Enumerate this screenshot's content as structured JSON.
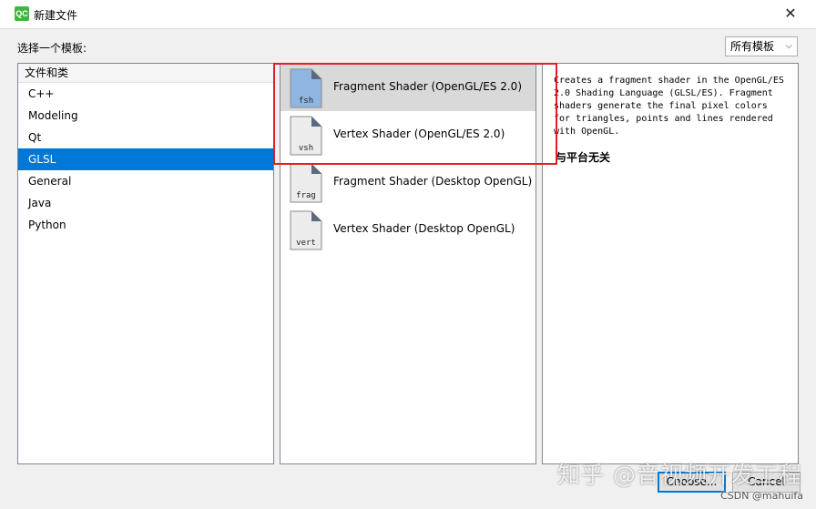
{
  "window": {
    "title": "新建文件",
    "logo_text": "QC",
    "close_glyph": "✕"
  },
  "toolbar": {
    "choose_label": "选择一个模板:",
    "filter_value": "所有模板",
    "filter_chevron": "⌵"
  },
  "categories": {
    "header": "文件和类",
    "items": [
      {
        "label": "C++",
        "selected": false
      },
      {
        "label": "Modeling",
        "selected": false
      },
      {
        "label": "Qt",
        "selected": false
      },
      {
        "label": "GLSL",
        "selected": true
      },
      {
        "label": "General",
        "selected": false
      },
      {
        "label": "Java",
        "selected": false
      },
      {
        "label": "Python",
        "selected": false
      }
    ]
  },
  "templates": {
    "items": [
      {
        "label": "Fragment Shader (OpenGL/ES 2.0)",
        "icon_text": "fsh",
        "icon": "file-fsh-icon",
        "selected": true
      },
      {
        "label": "Vertex Shader (OpenGL/ES 2.0)",
        "icon_text": "vsh",
        "icon": "file-vsh-icon",
        "selected": false
      },
      {
        "label": "Fragment Shader (Desktop OpenGL)",
        "icon_text": "frag",
        "icon": "file-frag-icon",
        "selected": false
      },
      {
        "label": "Vertex Shader (Desktop OpenGL)",
        "icon_text": "vert",
        "icon": "file-vert-icon",
        "selected": false
      }
    ]
  },
  "description": {
    "lines": [
      "Creates a fragment shader in the OpenGL/ES",
      "2.0 Shading Language (GLSL/ES). Fragment",
      "shaders generate the final pixel colors",
      "for triangles, points and lines rendered",
      "with OpenGL."
    ],
    "platform": "与平台无关"
  },
  "buttons": {
    "choose": "Choose...",
    "cancel": "Cancel"
  },
  "watermarks": {
    "zhihu": "知乎 @音视频开发工程",
    "csdn": "CSDN @mahuifa"
  },
  "colors": {
    "selection": "#0078d7",
    "highlight_box": "#e02020",
    "file_icon_selected": "#8fb6e0",
    "file_icon": "#ececec"
  }
}
